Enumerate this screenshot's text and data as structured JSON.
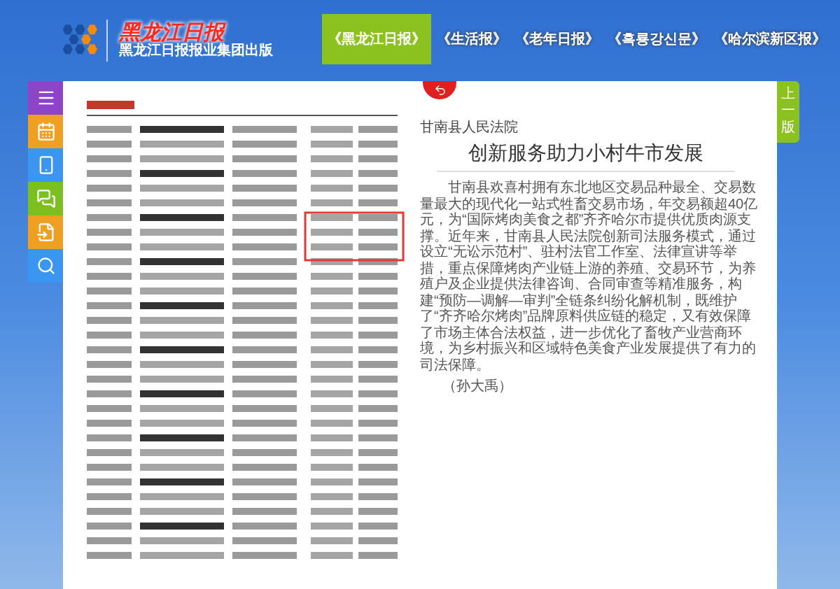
{
  "header": {
    "logo_text": "黑龙江日报",
    "publisher": "黑龙江日报报业集团出版"
  },
  "tabs": [
    {
      "label": "《黑龙江日报》",
      "selected": true
    },
    {
      "label": "《生活报》",
      "selected": false
    },
    {
      "label": "《老年日报》",
      "selected": false
    },
    {
      "label": "《흑룡강신문》",
      "selected": false
    },
    {
      "label": "《哈尔滨新区报》",
      "selected": false
    }
  ],
  "sidebar": [
    {
      "kind": "menu",
      "color": "#8e44c8"
    },
    {
      "kind": "calendar",
      "color": "#f0a020"
    },
    {
      "kind": "phone",
      "color": "#3a96f0"
    },
    {
      "kind": "wechat",
      "color": "#7cc020"
    },
    {
      "kind": "past",
      "color": "#f0a020"
    },
    {
      "kind": "search",
      "color": "#3a96f0"
    }
  ],
  "article": {
    "source": "甘南县人民法院",
    "title": "创新服务助力小村牛市发展",
    "body": "甘南县欢喜村拥有东北地区交易品种最全、交易数量最大的现代化一站式牲畜交易市场，年交易额超40亿元，为“国际烤肉美食之都”齐齐哈尔市提供优质肉源支撑。近年来，甘南县人民法院创新司法服务模式，通过设立“无讼示范村”、驻村法官工作室、法律宣讲等举措，重点保障烤肉产业链上游的养殖、交易环节，为养殖户及企业提供法律咨询、合同审查等精准服务，构建“预防—调解—审判”全链条纠纷化解机制，既维护了“齐齐哈尔烤肉”品牌原料供应链的稳定，又有效保障了市场主体合法权益，进一步优化了畜牧产业营商环境，为乡村振兴和区域特色美食产业发展提供了有力的司法保障。",
    "author": "（孙大禹）"
  },
  "prev_page": "上一版"
}
